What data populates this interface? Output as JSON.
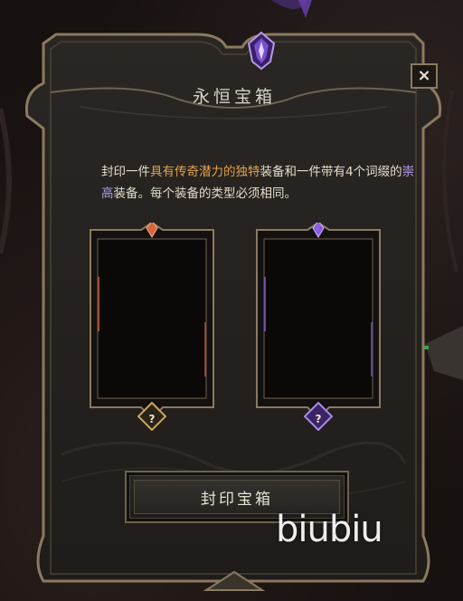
{
  "dialog": {
    "title": "永恒宝箱",
    "close_label": "×",
    "description": {
      "part1": "封印一件",
      "legendary": "具有传奇潜力的独特",
      "part2": "装备和一件带有4个词缀的",
      "exalted": "崇高",
      "part3": "装备。每个装备的类型必须相同。"
    },
    "slots": [
      {
        "name": "legendary-slot",
        "hint": "?",
        "accent": "#d8643a"
      },
      {
        "name": "exalted-slot",
        "hint": "?",
        "accent": "#8a5ee0"
      }
    ],
    "seal_button_label": "封印宝箱"
  },
  "watermark": "biubiu",
  "colors": {
    "legendary_text": "#e3a24a",
    "exalted_text": "#b49be8",
    "panel_bg": "#23201d",
    "frame_gold": "#8a7a60"
  }
}
